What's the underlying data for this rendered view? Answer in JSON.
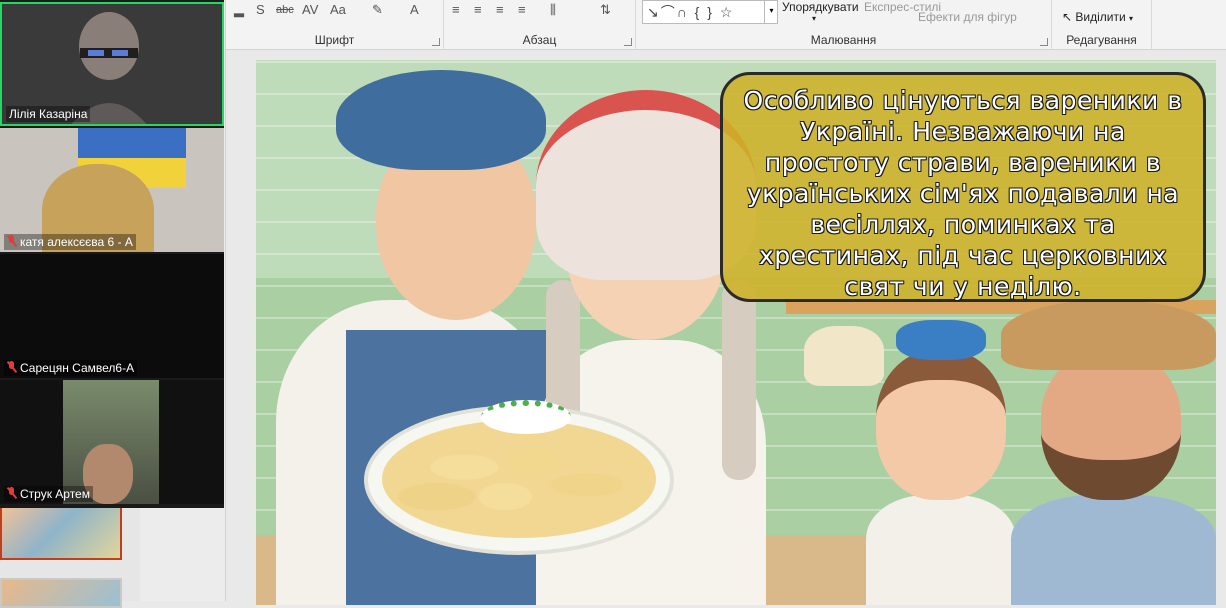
{
  "ribbon": {
    "groups": {
      "font": "Шрифт",
      "paragraph": "Абзац",
      "drawing": "Малювання",
      "editing": "Редагування"
    },
    "tools": {
      "shadow": "S",
      "strikethrough": "abc",
      "spacing": "AV",
      "case": "Aa",
      "font_color": "A"
    },
    "drawing": {
      "shapes": "↘⌒∩ { } ☆",
      "arrange": "Упорядкувати",
      "quick_styles": "Експрес-стилі",
      "shape_effects": "Ефекти для фігур"
    },
    "editing": {
      "select": "Виділити"
    }
  },
  "participants": [
    {
      "name": "Лілія Казаріна",
      "muted": false
    },
    {
      "name": "катя алексєєва 6 - А",
      "muted": true
    },
    {
      "name": "Сарецян Самвел6-А",
      "muted": true
    },
    {
      "name": "Струк Артем",
      "muted": true
    }
  ],
  "slide": {
    "bubble_text": "Особливо цінуються вареники в Україні. Незважаючи на простоту страви, вареники в українських сім'ях подавали на весіллях, поминках та хрестинах, під час церковних свят чи у неділю."
  },
  "colors": {
    "accent": "#c43e1c",
    "active_speaker": "#23d95f",
    "bubble": "#ceb228",
    "muted_mic": "#e23b3b"
  }
}
